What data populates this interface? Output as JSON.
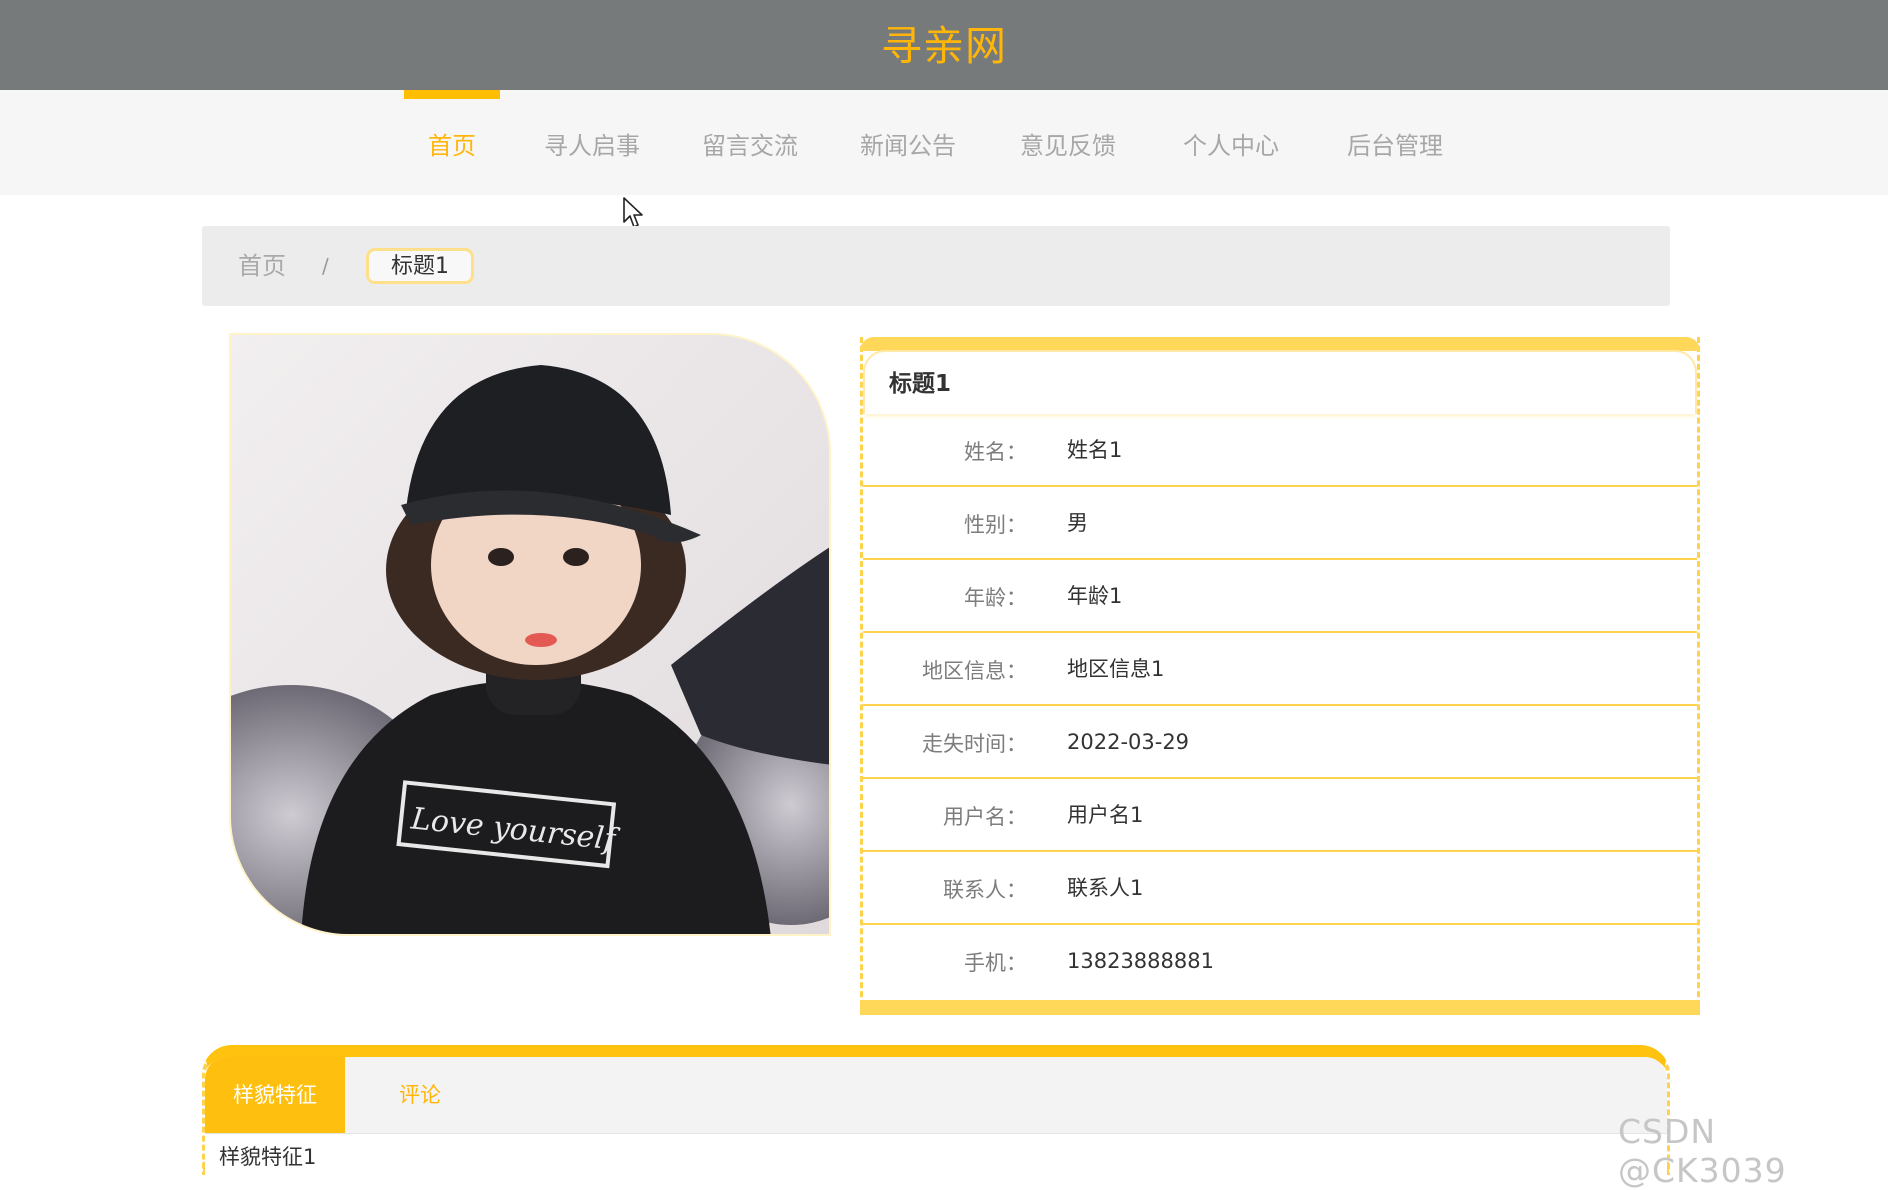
{
  "header": {
    "site_title": "寻亲网"
  },
  "nav": {
    "items": [
      {
        "label": "首页",
        "active": true
      },
      {
        "label": "寻人启事"
      },
      {
        "label": "留言交流"
      },
      {
        "label": "新闻公告"
      },
      {
        "label": "意见反馈"
      },
      {
        "label": "个人中心"
      },
      {
        "label": "后台管理"
      }
    ]
  },
  "breadcrumb": {
    "home": "首页",
    "separator": "/",
    "current": "标题1"
  },
  "detail": {
    "title": "标题1",
    "fields": [
      {
        "label": "姓名：",
        "value": "姓名1"
      },
      {
        "label": "性别：",
        "value": "男"
      },
      {
        "label": "年龄：",
        "value": "年龄1"
      },
      {
        "label": "地区信息：",
        "value": "地区信息1"
      },
      {
        "label": "走失时间：",
        "value": "2022-03-29"
      },
      {
        "label": "用户名：",
        "value": "用户名1"
      },
      {
        "label": "联系人：",
        "value": "联系人1"
      },
      {
        "label": "手机：",
        "value": "13823888881"
      }
    ]
  },
  "photo": {
    "shirt_text": "Love yourself"
  },
  "tabs": {
    "items": [
      {
        "label": "样貌特征",
        "active": true
      },
      {
        "label": "评论"
      }
    ],
    "content": "样貌特征1"
  },
  "watermark": "CSDN @CK3039",
  "colors": {
    "accent": "#ffb609",
    "header_bg": "#767a7b",
    "border": "#ffd24d"
  }
}
